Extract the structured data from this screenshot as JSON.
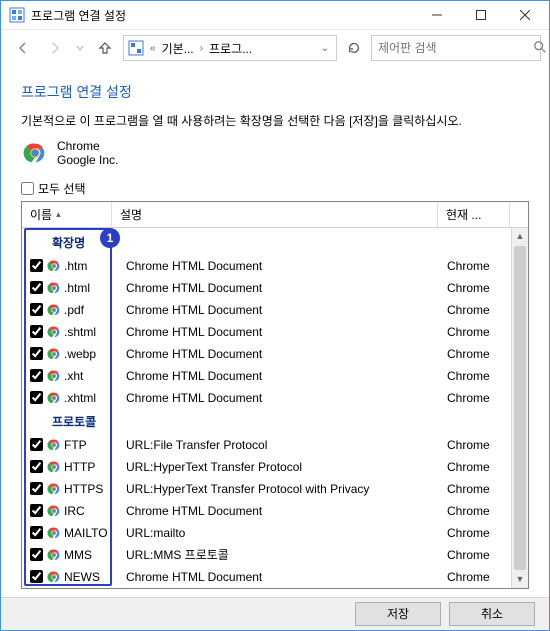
{
  "titlebar": {
    "title": "프로그램 연결 설정"
  },
  "nav": {
    "breadcrumb_prefix": "«",
    "crumb1": "기본...",
    "crumb2": "프로그...",
    "search_placeholder": "제어판 검색"
  },
  "page": {
    "heading": "프로그램 연결 설정",
    "description": "기본적으로 이 프로그램을 열 때 사용하려는 확장명을 선택한 다음 [저장]을 클릭하십시오.",
    "app_name": "Chrome",
    "app_publisher": "Google Inc.",
    "select_all_label": "모두 선택"
  },
  "grid": {
    "columns": {
      "name": "이름",
      "desc": "설명",
      "current": "현재 ..."
    },
    "group_ext": "확장명",
    "group_proto": "프로토콜",
    "ext_rows": [
      {
        "name": ".htm",
        "desc": "Chrome HTML Document",
        "current": "Chrome"
      },
      {
        "name": ".html",
        "desc": "Chrome HTML Document",
        "current": "Chrome"
      },
      {
        "name": ".pdf",
        "desc": "Chrome HTML Document",
        "current": "Chrome"
      },
      {
        "name": ".shtml",
        "desc": "Chrome HTML Document",
        "current": "Chrome"
      },
      {
        "name": ".webp",
        "desc": "Chrome HTML Document",
        "current": "Chrome"
      },
      {
        "name": ".xht",
        "desc": "Chrome HTML Document",
        "current": "Chrome"
      },
      {
        "name": ".xhtml",
        "desc": "Chrome HTML Document",
        "current": "Chrome"
      }
    ],
    "proto_rows": [
      {
        "name": "FTP",
        "desc": "URL:File Transfer Protocol",
        "current": "Chrome"
      },
      {
        "name": "HTTP",
        "desc": "URL:HyperText Transfer Protocol",
        "current": "Chrome"
      },
      {
        "name": "HTTPS",
        "desc": "URL:HyperText Transfer Protocol with Privacy",
        "current": "Chrome"
      },
      {
        "name": "IRC",
        "desc": "Chrome HTML Document",
        "current": "Chrome"
      },
      {
        "name": "MAILTO",
        "desc": "URL:mailto",
        "current": "Chrome"
      },
      {
        "name": "MMS",
        "desc": "URL:MMS 프로토콜",
        "current": "Chrome"
      },
      {
        "name": "NEWS",
        "desc": "Chrome HTML Document",
        "current": "Chrome"
      }
    ]
  },
  "annotation": {
    "badge": "1"
  },
  "footer": {
    "save": "저장",
    "cancel": "취소"
  }
}
